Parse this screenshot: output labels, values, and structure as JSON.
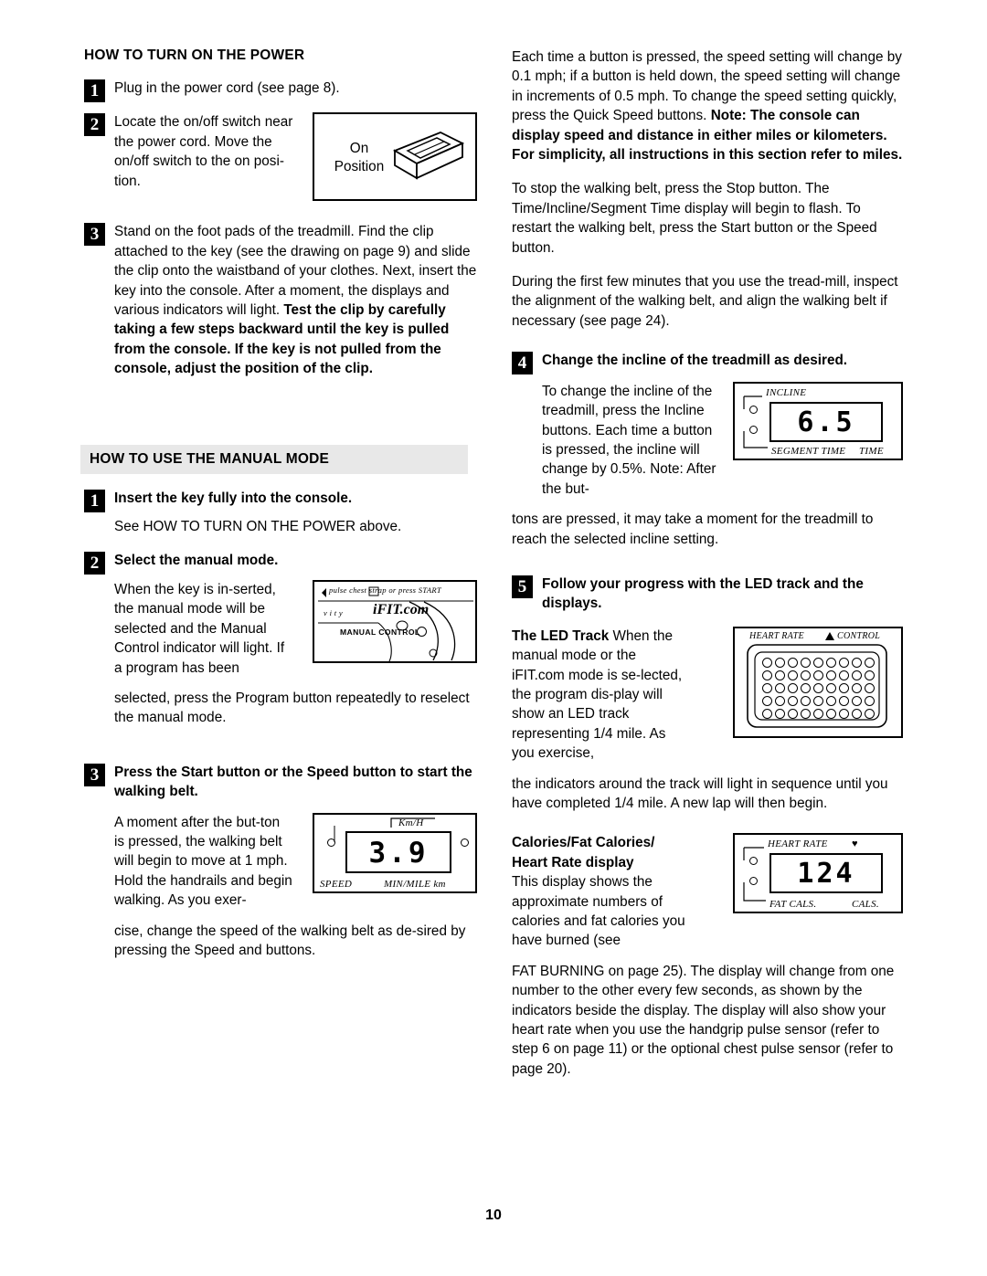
{
  "page": {
    "number": "10"
  },
  "left_column": {
    "section1": {
      "heading": "HOW TO TURN ON THE POWER",
      "steps": [
        {
          "num": "1",
          "text": "Plug in the power cord (see page 8)."
        },
        {
          "num": "2",
          "text": "Locate the on/off switch near the power cord. Move the on/off switch to the on posi-tion."
        },
        {
          "num": "3",
          "text_plain": "Stand on the foot pads of the treadmill. Find the clip attached to the key (see the drawing on page 9) and slide the clip onto the waistband of your clothes. Next, insert the key into the console. After a moment, the displays and various indicators will light. ",
          "text_bold": "Test the clip by carefully taking a few steps backward until the key is pulled from the console. If the key is not pulled from the console, adjust the position of the clip."
        }
      ],
      "switch_figure": {
        "label_line1": "On",
        "label_line2": "Position"
      }
    },
    "section2": {
      "heading": "HOW TO USE THE MANUAL MODE",
      "steps": [
        {
          "num": "1",
          "bold": "Insert the key fully into the console.",
          "body": "See HOW TO TURN ON THE POWER above."
        },
        {
          "num": "2",
          "bold": "Select the manual mode.",
          "body": "When the key is in-serted, the manual mode will be selected and the Manual Control indicator will light. If a program has been",
          "cont": "selected, press the Program button repeatedly to reselect the manual mode."
        },
        {
          "num": "3",
          "bold": "Press the Start button or the Speed    button to start the walking belt.",
          "body": "A moment after the but-ton is pressed, the walking belt will begin to move at 1 mph. Hold the handrails and begin walking. As you exer-",
          "cont": "cise, change the speed of the walking belt as de-sired by pressing the Speed    and    buttons."
        }
      ],
      "ifit_figure": {
        "top_label": "pulse chest strap  or  press START",
        "mid_label": "v  i  t  y",
        "logo": "iFIT.com",
        "manual_control": "MANUAL CONTROL"
      },
      "speed_display": {
        "value": "3.9",
        "unit": "Km/H",
        "caption_left": "SPEED",
        "caption_right": "MIN/MILE km"
      }
    }
  },
  "right_column": {
    "paragraphs": [
      {
        "plain": "Each time a button is pressed, the speed setting will change by 0.1 mph; if a button is held down, the speed setting will change in increments of 0.5 mph. To change the speed setting quickly, press the Quick Speed buttons. ",
        "bold": "Note: The console can display speed and distance in either miles or kilometers. For simplicity, all instructions in this section refer to miles."
      },
      {
        "plain": "To stop the walking belt, press the Stop button. The Time/Incline/Segment Time display will begin to flash. To restart the walking belt, press the Start button or the Speed    button.",
        "bold": ""
      },
      {
        "plain": "During the first few minutes that you use the tread-mill, inspect the alignment of the walking belt, and align the walking belt if necessary (see page 24).",
        "bold": ""
      }
    ],
    "steps": [
      {
        "num": "4",
        "bold": "Change the incline of the treadmill as desired.",
        "body": "To change the incline of the treadmill, press the Incline buttons. Each time a button is pressed, the incline will change by 0.5%. Note: After the but-",
        "cont": "tons are pressed, it may take a moment for the treadmill to reach the selected incline setting."
      },
      {
        "num": "5",
        "bold": "Follow your progress with the LED track and the displays.",
        "sub1_bold": "The LED Track ",
        "sub1_plain": "When the manual mode or the iFIT.com mode is se-lected, the program dis-play will show an LED track representing 1/4 mile. As you exercise,",
        "sub1_cont": "the indicators around the track will light in sequence until you have completed 1/4 mile. A new lap will then begin.",
        "sub2_bold_line1": "Calories/Fat Calories/",
        "sub2_bold_line2": "Heart Rate display",
        "sub2_plain": "This display shows the approximate numbers of calories and fat calories you have burned (see",
        "sub2_cont": "FAT BURNING on page 25). The display will change from one number to the other every few seconds, as shown by the indicators beside the display. The display will also show your heart rate when you use the handgrip pulse sensor (refer to step 6 on page 11) or the optional chest pulse sensor (refer to page 20)."
      }
    ],
    "incline_display": {
      "label_top": "INCLINE",
      "value": "6.5",
      "caption_left": "SEGMENT TIME",
      "caption_right": "TIME"
    },
    "heart_track_display": {
      "label_left": "HEART RATE",
      "label_right": "CONTROL"
    },
    "calorie_display": {
      "label_top": "HEART RATE",
      "value": "124",
      "caption_left": "FAT CALS.",
      "caption_right": "CALS."
    }
  }
}
